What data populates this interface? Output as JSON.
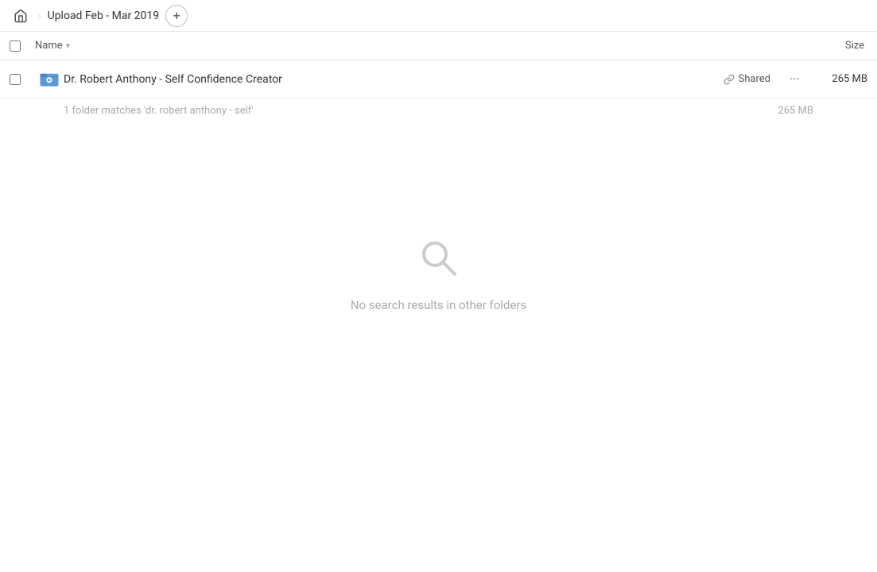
{
  "breadcrumb": {
    "home_label": "Home",
    "title": "Upload Feb - Mar 2019",
    "add_button_label": "+"
  },
  "column_headers": {
    "name_label": "Name",
    "sort_arrow": "▾",
    "size_label": "Size"
  },
  "file_row": {
    "name": "Dr. Robert Anthony - Self Confidence Creator",
    "shared_label": "Shared",
    "size": "265 MB",
    "more_label": "···"
  },
  "match_info": {
    "text": "1 folder matches 'dr. robert anthony - self'",
    "size": "265 MB"
  },
  "empty_state": {
    "message": "No search results in other folders"
  }
}
